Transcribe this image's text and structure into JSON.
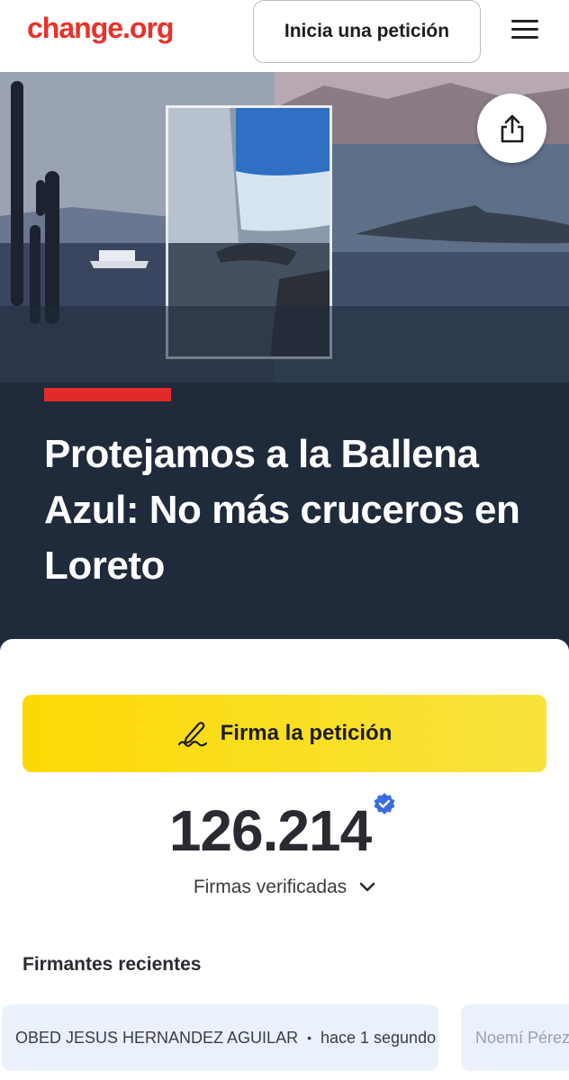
{
  "header": {
    "logo_text": "change.org",
    "start_petition_label": "Inicia una petición",
    "menu_icon": "hamburger-menu-icon"
  },
  "hero": {
    "share_icon": "share-icon"
  },
  "petition": {
    "title": "Protejamos a la Ballena Azul: No más cruceros en Loreto",
    "sign_label": "Firma la petición",
    "sign_icon": "pen-sign-icon",
    "signature_count": "126.214",
    "verified_label": "Firmas verificadas"
  },
  "recent_signers": {
    "title": "Firmantes recientes",
    "items": [
      {
        "name": "OBED JESUS HERNANDEZ AGUILAR",
        "time": "hace 1 segundo"
      },
      {
        "name": "Noemí Pérez",
        "time": ""
      }
    ]
  },
  "colors": {
    "brand_red": "#e8322b",
    "accent_bar": "#e12b2b",
    "sign_button_yellow": "#fcd904",
    "hero_dark": "#1f2a3b",
    "verified_blue": "#3b6de0",
    "chip_bg": "#eaf1fb"
  }
}
